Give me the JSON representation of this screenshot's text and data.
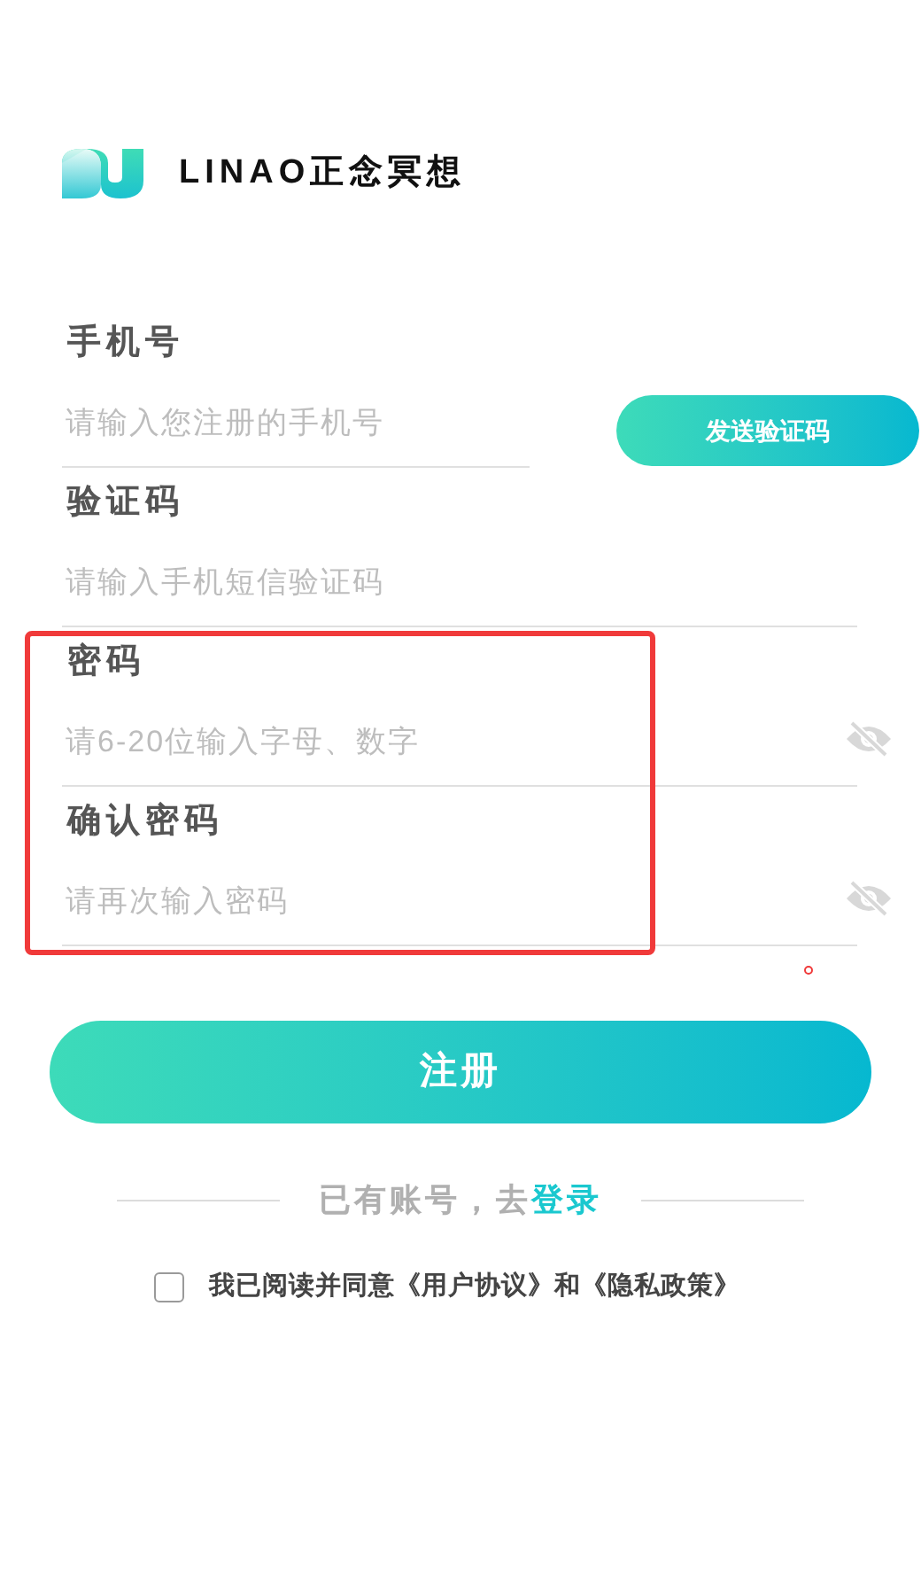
{
  "brand": {
    "name": "LINAO正念冥想"
  },
  "fields": [
    {
      "kind": "phone",
      "label": "手机号",
      "placeholder": "请输入您注册的手机号",
      "button": "发送验证码"
    },
    {
      "kind": "text",
      "label": "验证码",
      "placeholder": "请输入手机短信验证码"
    },
    {
      "kind": "password",
      "label": "密码",
      "placeholder": "请6-20位输入字母、数字"
    },
    {
      "kind": "password",
      "label": "确认密码",
      "placeholder": "请再次输入密码"
    }
  ],
  "submit": "注册",
  "login_prompt": {
    "text": "已有账号，去",
    "link": "登录"
  },
  "agreement": {
    "checked": false,
    "text": "我已阅读并同意《用户协议》和《隐私政策》"
  }
}
